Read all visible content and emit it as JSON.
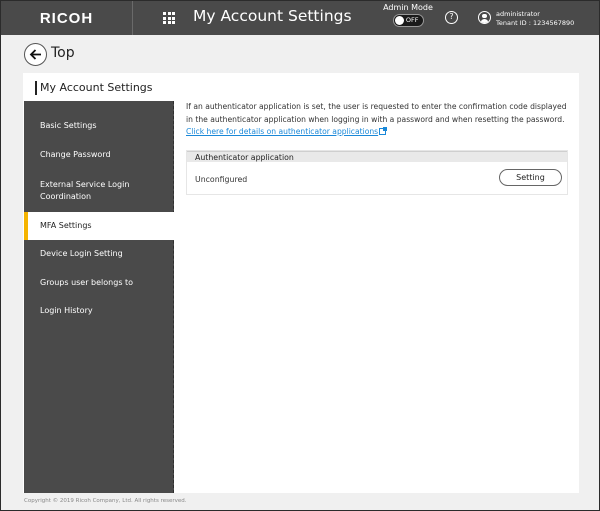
{
  "header": {
    "logo": "RICOH",
    "app_icon": "apps-grid-icon",
    "title": "My Account Settings",
    "admin_mode": {
      "label": "Admin Mode",
      "state": "OFF"
    },
    "help_icon": "help-icon",
    "help_glyph": "?",
    "user": {
      "icon": "user-icon",
      "name": "administrator",
      "tenant": "Tenant ID : 1234567890"
    }
  },
  "nav": {
    "back_icon": "arrow-left-icon",
    "back_label": "Top"
  },
  "panel": {
    "title": "My Account Settings"
  },
  "sidebar": {
    "items": [
      {
        "label": "Basic Settings",
        "active": false
      },
      {
        "label": "Change Password",
        "active": false
      },
      {
        "label": "External Service Login Coordination",
        "active": false
      },
      {
        "label": "MFA Settings",
        "active": true
      },
      {
        "label": "Device Login Setting",
        "active": false
      },
      {
        "label": "Groups user belongs to",
        "active": false
      },
      {
        "label": "Login History",
        "active": false
      }
    ],
    "active_color": "#f5b400"
  },
  "content": {
    "description": "If an authenticator application is set, the user is requested to enter the confirmation code displayed in the authenticator application when logging in with a password and when resetting the password.",
    "link_label": "Click here for details on authenticator applications",
    "link_icon": "external-link-icon",
    "link_color": "#1a88d8",
    "section": {
      "header": "Authenticator application",
      "status": "Unconfigured",
      "button_label": "Setting"
    }
  },
  "footer": {
    "copyright": "Copyright © 2019 Ricoh Company, Ltd. All rights reserved."
  }
}
